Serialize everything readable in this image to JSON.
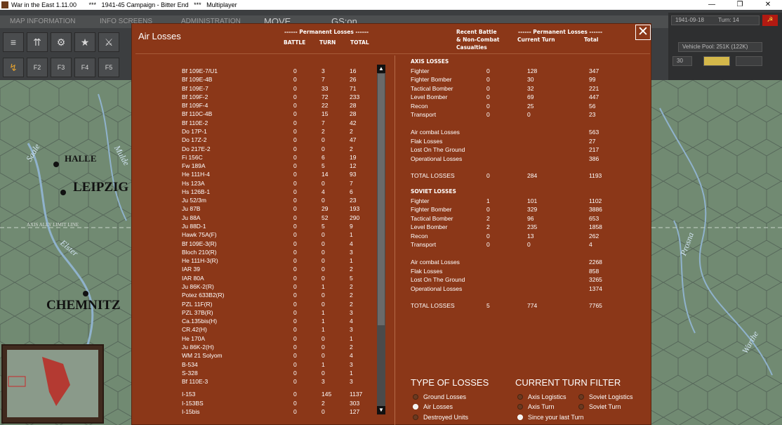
{
  "window": {
    "title": "War in the East 1.11.00       ***   1941-45 Campaign - Bitter End   ***   Multiplayer",
    "controls": [
      "—",
      "❐",
      "✕"
    ]
  },
  "topbar": {
    "menu": [
      "MAP INFORMATION",
      "INFO SCREENS",
      "ADMINISTRATION",
      "MOVE",
      "GS:on"
    ],
    "row1_icons": [
      "≡",
      "⇈",
      "⚙",
      "★",
      "⚔"
    ],
    "row2_icons": [
      "↯",
      "F2",
      "F3",
      "F4",
      "F5"
    ],
    "date": "1941-09-18",
    "turn": "Turn: 14",
    "vehicle_pool": "Vehicle Pool: 251K (122K)",
    "field_value": "30",
    "flag_symbol": "☭"
  },
  "map": {
    "towns": [
      "HALLE",
      "LEIPZIG",
      "CHEMNITZ"
    ],
    "rivers": [
      "Saale",
      "Mulde",
      "Elster",
      "Prosna",
      "Warthe"
    ],
    "limit_line": "AXIS ALLY LIMIT LINE"
  },
  "dialog": {
    "title": "Air Losses",
    "close_label": "✕",
    "headers": {
      "perm_left": "------ Permanent Losses ------",
      "battle": "BATTLE",
      "turn": "TURN",
      "total": "TOTAL",
      "recent": "Recent Battle\n& Non-Combat\nCasualties",
      "perm_right": "------ Permanent Losses ------",
      "current_turn": "Current Turn",
      "total_right": "Total"
    },
    "aircraft": [
      {
        "name": "Bf 109E-7/U1",
        "battle": "0",
        "turn": "3",
        "total": "16"
      },
      {
        "name": "Bf 109E-4B",
        "battle": "0",
        "turn": "7",
        "total": "26"
      },
      {
        "name": "Bf 109E-7",
        "battle": "0",
        "turn": "33",
        "total": "71"
      },
      {
        "name": "Bf 109F-2",
        "battle": "0",
        "turn": "72",
        "total": "233"
      },
      {
        "name": "Bf 109F-4",
        "battle": "0",
        "turn": "22",
        "total": "28"
      },
      {
        "name": "Bf 110C-4B",
        "battle": "0",
        "turn": "15",
        "total": "28"
      },
      {
        "name": "Bf 110E-2",
        "battle": "0",
        "turn": "7",
        "total": "42"
      },
      {
        "name": "Do 17P-1",
        "battle": "0",
        "turn": "2",
        "total": "2"
      },
      {
        "name": "Do 17Z-2",
        "battle": "0",
        "turn": "0",
        "total": "47"
      },
      {
        "name": "Do 217E-2",
        "battle": "0",
        "turn": "0",
        "total": "2"
      },
      {
        "name": "Fi 156C",
        "battle": "0",
        "turn": "6",
        "total": "19"
      },
      {
        "name": "Fw 189A",
        "battle": "0",
        "turn": "5",
        "total": "12"
      },
      {
        "name": "He 111H-4",
        "battle": "0",
        "turn": "14",
        "total": "93"
      },
      {
        "name": "Hs 123A",
        "battle": "0",
        "turn": "0",
        "total": "7"
      },
      {
        "name": "Hs 126B-1",
        "battle": "0",
        "turn": "4",
        "total": "6"
      },
      {
        "name": "Ju 52/3m",
        "battle": "0",
        "turn": "0",
        "total": "23"
      },
      {
        "name": "Ju 87B",
        "battle": "0",
        "turn": "29",
        "total": "193"
      },
      {
        "name": "Ju 88A",
        "battle": "0",
        "turn": "52",
        "total": "290"
      },
      {
        "name": "Ju 88D-1",
        "battle": "0",
        "turn": "5",
        "total": "9"
      },
      {
        "name": "Hawk 75A(F)",
        "battle": "0",
        "turn": "0",
        "total": "1"
      },
      {
        "name": "Bf 109E-3(R)",
        "battle": "0",
        "turn": "0",
        "total": "4"
      },
      {
        "name": "Bloch 210(R)",
        "battle": "0",
        "turn": "0",
        "total": "3"
      },
      {
        "name": "He 111H-3(R)",
        "battle": "0",
        "turn": "0",
        "total": "1"
      },
      {
        "name": "IAR 39",
        "battle": "0",
        "turn": "0",
        "total": "2"
      },
      {
        "name": "IAR 80A",
        "battle": "0",
        "turn": "0",
        "total": "5"
      },
      {
        "name": "Ju 86K-2(R)",
        "battle": "0",
        "turn": "1",
        "total": "2"
      },
      {
        "name": "Potez 633B2(R)",
        "battle": "0",
        "turn": "0",
        "total": "2"
      },
      {
        "name": "PZL 11F(R)",
        "battle": "0",
        "turn": "0",
        "total": "2"
      },
      {
        "name": "PZL 37B(R)",
        "battle": "0",
        "turn": "1",
        "total": "3"
      },
      {
        "name": "Ca.135bis(H)",
        "battle": "0",
        "turn": "1",
        "total": "4"
      },
      {
        "name": "CR.42(H)",
        "battle": "0",
        "turn": "1",
        "total": "3"
      },
      {
        "name": "He 170A",
        "battle": "0",
        "turn": "0",
        "total": "1"
      },
      {
        "name": "Ju 86K-2(H)",
        "battle": "0",
        "turn": "0",
        "total": "2"
      },
      {
        "name": "WM 21 Solyom",
        "battle": "0",
        "turn": "0",
        "total": "4"
      },
      {
        "name": "B-534",
        "battle": "0",
        "turn": "1",
        "total": "3"
      },
      {
        "name": "S-328",
        "battle": "0",
        "turn": "0",
        "total": "1"
      },
      {
        "name": "Bf 110E-3",
        "battle": "0",
        "turn": "3",
        "total": "3"
      },
      {
        "name": "I-153",
        "battle": "0",
        "turn": "145",
        "total": "1137"
      },
      {
        "name": "I-153BS",
        "battle": "0",
        "turn": "2",
        "total": "303"
      },
      {
        "name": "I-15bis",
        "battle": "0",
        "turn": "0",
        "total": "127"
      }
    ],
    "axis": {
      "title": "AXIS LOSSES",
      "types": [
        {
          "name": "Fighter",
          "recent": "0",
          "turn": "128",
          "total": "347"
        },
        {
          "name": "Fighter Bomber",
          "recent": "0",
          "turn": "30",
          "total": "99"
        },
        {
          "name": "Tactical Bomber",
          "recent": "0",
          "turn": "32",
          "total": "221"
        },
        {
          "name": "Level Bomber",
          "recent": "0",
          "turn": "69",
          "total": "447"
        },
        {
          "name": "Recon",
          "recent": "0",
          "turn": "25",
          "total": "56"
        },
        {
          "name": "Transport",
          "recent": "0",
          "turn": "0",
          "total": "23"
        }
      ],
      "causes": [
        {
          "name": "Air combat Losses",
          "total": "563"
        },
        {
          "name": "Flak Losses",
          "total": "27"
        },
        {
          "name": "Lost On The Ground",
          "total": "217"
        },
        {
          "name": "Operational Losses",
          "total": "386"
        }
      ],
      "totals": {
        "name": "TOTAL LOSSES",
        "recent": "0",
        "turn": "284",
        "total": "1193"
      }
    },
    "soviet": {
      "title": "SOVIET LOSSES",
      "types": [
        {
          "name": "Fighter",
          "recent": "1",
          "turn": "101",
          "total": "1102"
        },
        {
          "name": "Fighter Bomber",
          "recent": "0",
          "turn": "329",
          "total": "3886"
        },
        {
          "name": "Tactical Bomber",
          "recent": "2",
          "turn": "96",
          "total": "653"
        },
        {
          "name": "Level Bomber",
          "recent": "2",
          "turn": "235",
          "total": "1858"
        },
        {
          "name": "Recon",
          "recent": "0",
          "turn": "13",
          "total": "262"
        },
        {
          "name": "Transport",
          "recent": "0",
          "turn": "0",
          "total": "4"
        }
      ],
      "causes": [
        {
          "name": "Air combat Losses",
          "total": "2268"
        },
        {
          "name": "Flak Losses",
          "total": "858"
        },
        {
          "name": "Lost On The Ground",
          "total": "3265"
        },
        {
          "name": "Operational Losses",
          "total": "1374"
        }
      ],
      "totals": {
        "name": "TOTAL LOSSES",
        "recent": "5",
        "turn": "774",
        "total": "7765"
      }
    },
    "type_of_losses": {
      "title": "TYPE OF LOSSES",
      "options": [
        "Ground Losses",
        "Air Losses",
        "Destroyed Units"
      ],
      "selected": "Air Losses"
    },
    "turn_filter": {
      "title": "CURRENT TURN FILTER",
      "options": [
        "Axis Logistics",
        "Soviet Logistics",
        "Axis Turn",
        "Soviet Turn",
        "Since your last Turn"
      ],
      "selected": "Since your last Turn"
    },
    "scroll": {
      "up": "▲",
      "down": "▼"
    }
  }
}
